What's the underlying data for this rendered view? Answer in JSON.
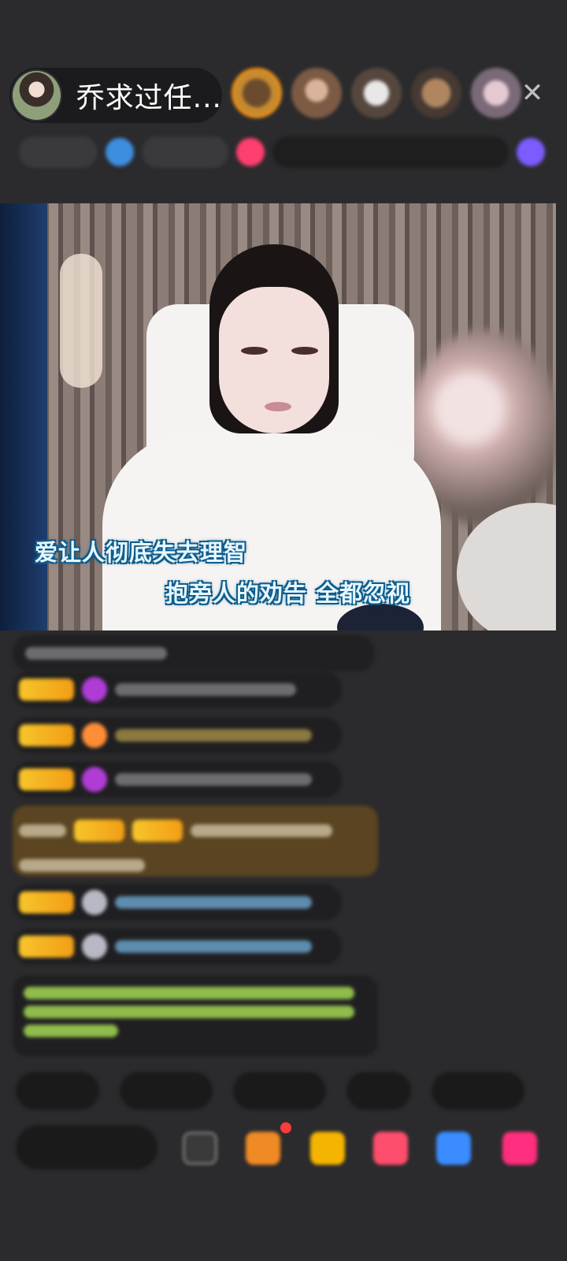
{
  "header": {
    "host_name": "乔求过任...",
    "close_label": "✕"
  },
  "stream": {
    "lyrics": [
      "爱让人彻底失去理智",
      "抱旁人的劝告  全都忽视"
    ]
  },
  "colors": {
    "accent_gold": "#f7c52b",
    "lyric_outline": "#0d5c8c",
    "background": "#2b2b2d"
  }
}
